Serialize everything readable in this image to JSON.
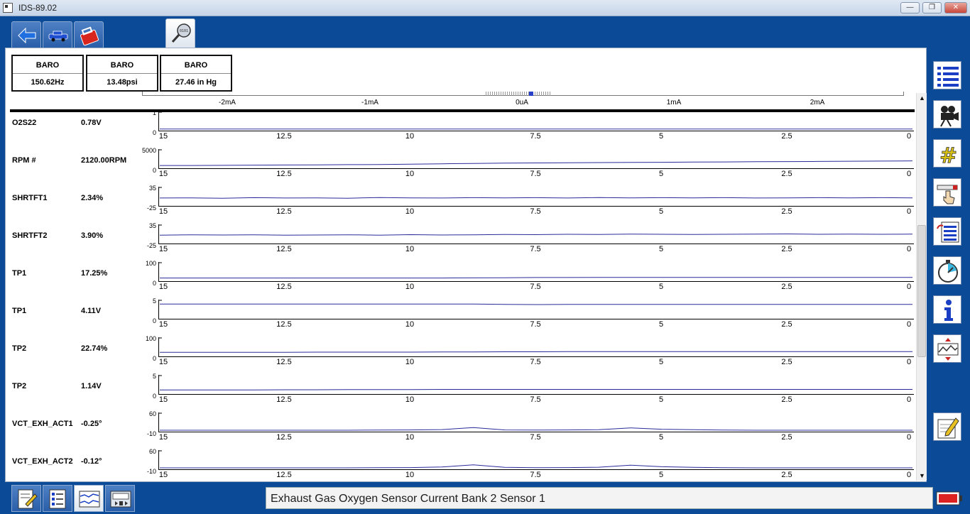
{
  "window": {
    "title": "IDS-89.02",
    "minimize": "—",
    "restore": "❐",
    "close": "✕"
  },
  "top_tabs": [
    {
      "name": "connect-icon"
    },
    {
      "name": "vehicle-icon"
    },
    {
      "name": "toolbox-icon"
    },
    {
      "name": "datalogger-icon"
    }
  ],
  "pid_boxes": [
    {
      "title": "BARO",
      "value": "150.62Hz"
    },
    {
      "title": "BARO",
      "value": "13.48psi"
    },
    {
      "title": "BARO",
      "value": "27.46 in Hg"
    }
  ],
  "current_axis": {
    "labels": [
      "-2mA",
      "-1mA",
      "0uA",
      "1mA",
      "2mA"
    ]
  },
  "x_ticks": [
    "15",
    "12.5",
    "10",
    "7.5",
    "5",
    "2.5",
    "0"
  ],
  "pids": [
    {
      "name": "O2S22",
      "value": "0.78V",
      "max": "1",
      "min": "0",
      "trace": [
        0.05,
        0.05,
        0.05,
        0.05,
        0.05,
        0.05,
        0.05,
        0.05,
        0.05,
        0.05,
        0.05,
        0.05,
        0.05,
        0.05,
        0.05,
        0.05,
        0.05,
        0.05,
        0.05,
        0.05,
        0.05,
        0.05,
        0.05,
        0.05,
        0.05
      ]
    },
    {
      "name": "RPM #",
      "value": "2120.00RPM",
      "max": "5000",
      "min": "0",
      "trace": [
        0.12,
        0.12,
        0.13,
        0.14,
        0.15,
        0.16,
        0.17,
        0.18,
        0.2,
        0.22,
        0.24,
        0.26,
        0.27,
        0.28,
        0.29,
        0.3,
        0.31,
        0.32,
        0.33,
        0.34,
        0.35,
        0.36,
        0.37,
        0.38,
        0.39
      ]
    },
    {
      "name": "SHRTFT1",
      "value": "2.34%",
      "max": "35",
      "min": "-25",
      "trace": [
        0.42,
        0.43,
        0.41,
        0.44,
        0.42,
        0.43,
        0.41,
        0.45,
        0.43,
        0.42,
        0.44,
        0.43,
        0.44,
        0.42,
        0.45,
        0.43,
        0.44,
        0.43,
        0.44,
        0.42,
        0.43,
        0.44,
        0.43,
        0.44,
        0.43
      ]
    },
    {
      "name": "SHRTFT2",
      "value": "3.90%",
      "max": "35",
      "min": "-25",
      "trace": [
        0.45,
        0.47,
        0.46,
        0.47,
        0.45,
        0.46,
        0.47,
        0.45,
        0.48,
        0.46,
        0.47,
        0.49,
        0.48,
        0.5,
        0.49,
        0.51,
        0.5,
        0.49,
        0.5,
        0.51,
        0.52,
        0.5,
        0.51,
        0.5,
        0.51
      ]
    },
    {
      "name": "TP1",
      "value": "17.25%",
      "max": "100",
      "min": "0",
      "trace": [
        0.14,
        0.14,
        0.14,
        0.14,
        0.14,
        0.14,
        0.14,
        0.14,
        0.14,
        0.14,
        0.15,
        0.16,
        0.17,
        0.17,
        0.18,
        0.18,
        0.18,
        0.18,
        0.18,
        0.18,
        0.18,
        0.18,
        0.18,
        0.18,
        0.18
      ]
    },
    {
      "name": "TP1",
      "value": "4.11V",
      "max": "5",
      "min": "0",
      "trace": [
        0.82,
        0.82,
        0.82,
        0.82,
        0.82,
        0.82,
        0.82,
        0.82,
        0.82,
        0.82,
        0.82,
        0.8,
        0.79,
        0.8,
        0.8,
        0.8,
        0.8,
        0.8,
        0.8,
        0.8,
        0.8,
        0.8,
        0.8,
        0.8,
        0.8
      ]
    },
    {
      "name": "TP2",
      "value": "22.74%",
      "max": "100",
      "min": "0",
      "trace": [
        0.2,
        0.2,
        0.2,
        0.2,
        0.2,
        0.21,
        0.21,
        0.21,
        0.21,
        0.22,
        0.22,
        0.23,
        0.23,
        0.24,
        0.24,
        0.24,
        0.24,
        0.24,
        0.24,
        0.24,
        0.24,
        0.24,
        0.24,
        0.24,
        0.24
      ]
    },
    {
      "name": "TP2",
      "value": "1.14V",
      "max": "5",
      "min": "0",
      "trace": [
        0.2,
        0.2,
        0.2,
        0.2,
        0.21,
        0.21,
        0.22,
        0.22,
        0.22,
        0.23,
        0.23,
        0.23,
        0.23,
        0.23,
        0.23,
        0.23,
        0.23,
        0.23,
        0.23,
        0.23,
        0.23,
        0.23,
        0.23,
        0.23,
        0.23
      ]
    },
    {
      "name": "VCT_EXH_ACT1",
      "value": "-0.25°",
      "max": "60",
      "min": "-10",
      "trace": [
        0.04,
        0.04,
        0.04,
        0.04,
        0.04,
        0.04,
        0.04,
        0.05,
        0.06,
        0.08,
        0.2,
        0.06,
        0.05,
        0.06,
        0.07,
        0.18,
        0.1,
        0.07,
        0.05,
        0.04,
        0.04,
        0.04,
        0.04,
        0.04,
        0.04
      ]
    },
    {
      "name": "VCT_EXH_ACT2",
      "value": "-0.12°",
      "max": "60",
      "min": "-10",
      "trace": [
        0.04,
        0.04,
        0.04,
        0.04,
        0.04,
        0.04,
        0.04,
        0.05,
        0.06,
        0.09,
        0.22,
        0.07,
        0.05,
        0.06,
        0.08,
        0.2,
        0.11,
        0.07,
        0.05,
        0.04,
        0.04,
        0.04,
        0.04,
        0.04,
        0.04
      ]
    }
  ],
  "right_toolbar": [
    {
      "name": "pid-list-icon"
    },
    {
      "name": "record-camera-icon"
    },
    {
      "name": "hash-grid-icon"
    },
    {
      "name": "trigger-pointer-icon"
    },
    {
      "name": "select-pids-icon"
    },
    {
      "name": "stopwatch-icon"
    },
    {
      "name": "info-icon"
    },
    {
      "name": "graph-scale-icon"
    },
    {
      "name": "notes-edit-icon"
    }
  ],
  "bottom_buttons": [
    {
      "name": "report-icon"
    },
    {
      "name": "checklist-icon"
    },
    {
      "name": "graph-view-icon"
    },
    {
      "name": "playback-icon"
    }
  ],
  "status_bar": {
    "text": "Exhaust Gas Oxygen Sensor Current Bank 2 Sensor 1"
  },
  "colors": {
    "accent": "#0b4a97",
    "trace": "#2a2a9a"
  }
}
